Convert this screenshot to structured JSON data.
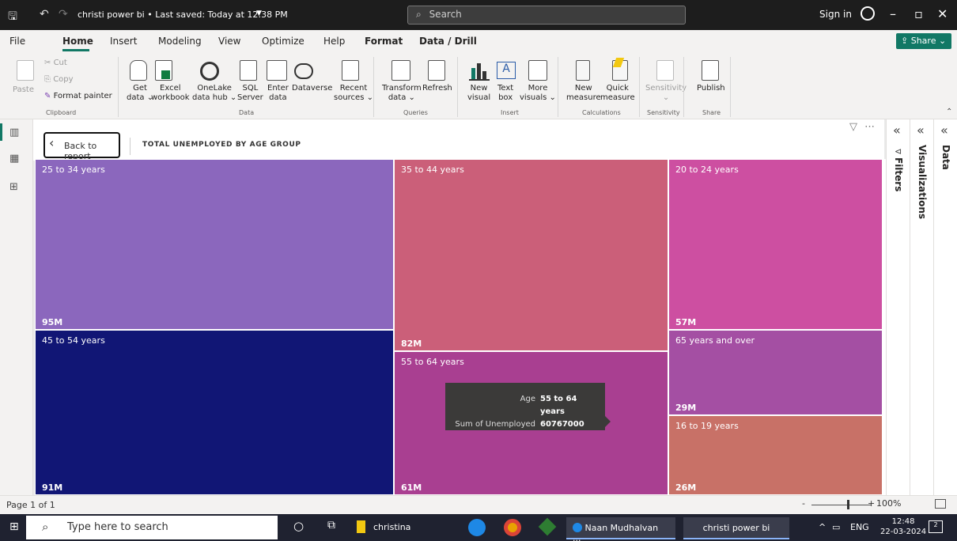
{
  "titlebar": {
    "doc_title": "christi power bi • Last saved: Today at 12:38 PM",
    "search_placeholder": "Search",
    "sign_in": "Sign in"
  },
  "menu": [
    "File",
    "Home",
    "Insert",
    "Modeling",
    "View",
    "Optimize",
    "Help",
    "Format",
    "Data / Drill"
  ],
  "share_label": "Share",
  "ribbon": {
    "clipboard": {
      "paste": "Paste",
      "cut": "Cut",
      "copy": "Copy",
      "format_painter": "Format painter",
      "group": "Clipboard"
    },
    "data": {
      "get_data": "Get",
      "get_data2": "data ⌄",
      "excel": "Excel",
      "excel2": "workbook",
      "onelake": "OneLake",
      "onelake2": "data hub ⌄",
      "sql": "SQL",
      "sql2": "Server",
      "enter": "Enter",
      "enter2": "data",
      "dataverse": "Dataverse",
      "recent": "Recent",
      "recent2": "sources ⌄",
      "group": "Data"
    },
    "queries": {
      "transform": "Transform",
      "transform2": "data ⌄",
      "refresh": "Refresh",
      "group": "Queries"
    },
    "insert": {
      "new_visual": "New",
      "new_visual2": "visual",
      "text_box": "Text",
      "text_box2": "box",
      "more": "More",
      "more2": "visuals ⌄",
      "group": "Insert"
    },
    "calculations": {
      "new_measure": "New",
      "new_measure2": "measure",
      "quick": "Quick",
      "quick2": "measure",
      "group": "Calculations"
    },
    "sensitivity": {
      "label": "Sensitivity",
      "group": "Sensitivity"
    },
    "share": {
      "publish": "Publish",
      "group": "Share"
    }
  },
  "visual": {
    "back_label": "Back to report",
    "title": "TOTAL UNEMPLOYED BY AGE GROUP"
  },
  "chart_data": {
    "type": "treemap",
    "title": "TOTAL UNEMPLOYED BY AGE GROUP",
    "items": [
      {
        "label": "25 to 34 years",
        "value_label": "95M",
        "color": "#8b67bd"
      },
      {
        "label": "45 to 54 years",
        "value_label": "91M",
        "color": "#111675"
      },
      {
        "label": "35 to 44 years",
        "value_label": "82M",
        "color": "#cb5f79"
      },
      {
        "label": "55 to 64 years",
        "value_label": "61M",
        "color": "#a93f91"
      },
      {
        "label": "20 to 24 years",
        "value_label": "57M",
        "color": "#cd4fa1"
      },
      {
        "label": "65 years and over",
        "value_label": "29M",
        "color": "#a44fa3"
      },
      {
        "label": "16 to 19 years",
        "value_label": "26M",
        "color": "#c87167"
      }
    ]
  },
  "tooltip": {
    "age_key": "Age",
    "age_value": "55 to 64 years",
    "sum_key": "Sum of Unemployed",
    "sum_value": "60767000"
  },
  "panes": {
    "filters": "Filters",
    "visualizations": "Visualizations",
    "data": "Data"
  },
  "status": {
    "page": "Page 1 of 1",
    "zoom": "100%"
  },
  "taskbar": {
    "search_placeholder": "Type here to search",
    "folder": "christina",
    "chrome_app": "Naan Mudhalvan ...",
    "pbi_app": "christi power bi",
    "lang": "ENG",
    "time": "12:48",
    "date": "22-03-2024",
    "notif_count": "2"
  }
}
